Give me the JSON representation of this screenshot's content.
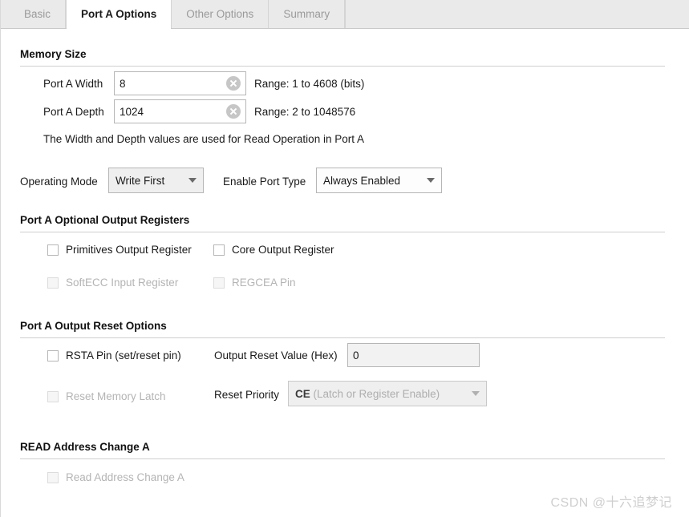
{
  "tabs": [
    {
      "label": "Basic",
      "active": false
    },
    {
      "label": "Port A Options",
      "active": true
    },
    {
      "label": "Other Options",
      "active": false
    },
    {
      "label": "Summary",
      "active": false
    }
  ],
  "memory_size": {
    "heading": "Memory Size",
    "width_label": "Port A Width",
    "width_value": "8",
    "width_range": "Range: 1 to 4608 (bits)",
    "depth_label": "Port A Depth",
    "depth_value": "1024",
    "depth_range": "Range: 2 to 1048576",
    "note": "The Width and Depth values are used for Read Operation in Port A"
  },
  "mode_row": {
    "operating_mode_label": "Operating Mode",
    "operating_mode_value": "Write First",
    "enable_port_type_label": "Enable Port Type",
    "enable_port_type_value": "Always Enabled"
  },
  "optional_output_registers": {
    "heading": "Port A Optional Output Registers",
    "items": [
      {
        "label": "Primitives Output Register",
        "checked": false,
        "disabled": false
      },
      {
        "label": "Core Output Register",
        "checked": false,
        "disabled": false
      },
      {
        "label": "SoftECC Input Register",
        "checked": false,
        "disabled": true
      },
      {
        "label": "REGCEA Pin",
        "checked": false,
        "disabled": true
      }
    ]
  },
  "reset_options": {
    "heading": "Port A Output Reset Options",
    "rsta_label": "RSTA Pin (set/reset pin)",
    "reset_memory_latch_label": "Reset Memory Latch",
    "output_reset_value_label": "Output Reset Value (Hex)",
    "output_reset_value": "0",
    "reset_priority_label": "Reset Priority",
    "reset_priority_value_strong": "CE",
    "reset_priority_value_sub": "(Latch or Register Enable)"
  },
  "read_address_change": {
    "heading": "READ Address Change A",
    "checkbox_label": "Read Address Change A"
  },
  "watermark": "CSDN @十六追梦记",
  "colors": {
    "tabbar_bg": "#eaeaea",
    "content_bg": "#ffffff",
    "rule": "#cfcfcf",
    "disabled_text": "#b4b4b4",
    "clear_button": "#c6c6c6"
  }
}
